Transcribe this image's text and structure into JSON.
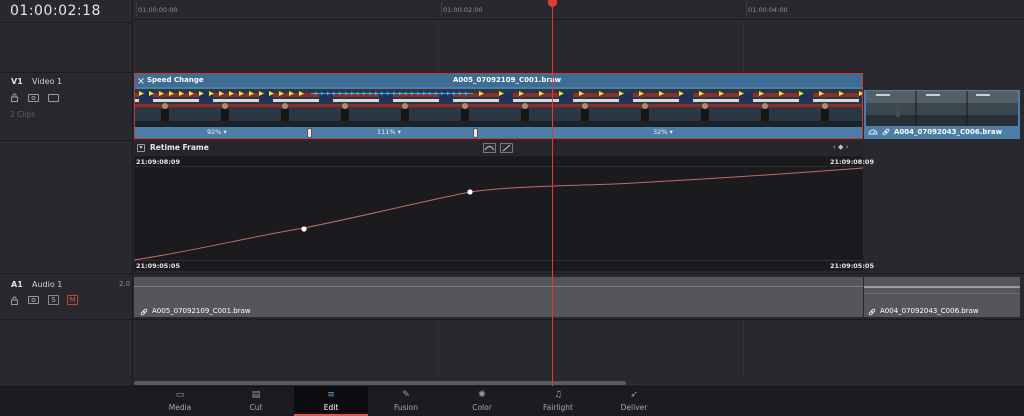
{
  "timecode": "01:00:02:18",
  "ruler": {
    "labels": [
      "01:00:00:00",
      "01:00:02:00",
      "01:00:04:00"
    ]
  },
  "tracks": {
    "v1": {
      "id": "V1",
      "name": "Video 1",
      "clips_count": "2 Clips"
    },
    "a1": {
      "id": "A1",
      "name": "Audio 1",
      "level": "2.0",
      "solo": "S",
      "mute": "M"
    }
  },
  "clip_v1": {
    "label": "Speed Change",
    "filename": "A005_07092109_C001.braw",
    "speeds": [
      "92%",
      "111%",
      "32%"
    ]
  },
  "clip_v1b": {
    "filename": "A004_07092043_C006.braw"
  },
  "retime": {
    "title": "Retime Frame",
    "top_left": "21:09:08:09",
    "top_right": "21:09:08:09",
    "bottom_left": "21:09:05:05",
    "bottom_right": "21:09:05:05"
  },
  "clip_a1": {
    "filename": "A005_07092109_C001.braw"
  },
  "clip_a1b": {
    "filename": "A004_07092043_C006.braw"
  },
  "nav": [
    {
      "label": "Media",
      "icon": "media-icon"
    },
    {
      "label": "Cut",
      "icon": "cut-icon"
    },
    {
      "label": "Edit",
      "icon": "edit-icon",
      "active": true
    },
    {
      "label": "Fusion",
      "icon": "fusion-icon"
    },
    {
      "label": "Color",
      "icon": "color-icon"
    },
    {
      "label": "Fairlight",
      "icon": "fairlight-icon"
    },
    {
      "label": "Deliver",
      "icon": "deliver-icon"
    }
  ],
  "colors": {
    "accent": "#e23b33",
    "clip_blue": "#4d7ea7",
    "audio_gray": "#55555c"
  }
}
